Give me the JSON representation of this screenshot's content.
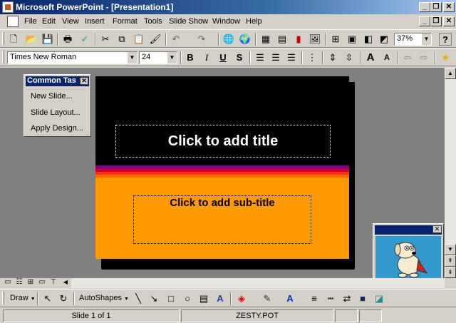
{
  "window": {
    "title": "Microsoft PowerPoint - [Presentation1]",
    "minimize_glyph": "_",
    "maximize_glyph": "❐",
    "close_glyph": "✕"
  },
  "menu": [
    "File",
    "Edit",
    "View",
    "Insert",
    "Format",
    "Tools",
    "Slide Show",
    "Window",
    "Help"
  ],
  "standard_toolbar": {
    "zoom": "37%",
    "help_glyph": "?"
  },
  "formatting_toolbar": {
    "font": "Times New Roman",
    "size": "24",
    "bold": "B",
    "italic": "I",
    "underline": "U",
    "shadow": "S"
  },
  "task_pane": {
    "title": "Common Tas",
    "items": [
      "New Slide...",
      "Slide Layout...",
      "Apply Design..."
    ]
  },
  "slide": {
    "title_placeholder": "Click to add title",
    "subtitle_placeholder": "Click to add sub-title",
    "colors": {
      "background": "#000000",
      "body": "#ff9900",
      "stripes": [
        "#800080",
        "#cc0033",
        "#ff3300",
        "#ff6600"
      ]
    }
  },
  "drawing_toolbar": {
    "draw": "Draw",
    "autoshapes": "AutoShapes"
  },
  "status_bar": {
    "slide": "Slide 1 of 1",
    "design": "ZESTY.POT"
  },
  "colors": {
    "title_bar": "#0a246a",
    "workspace": "#808080",
    "chrome": "#d4d0c8"
  }
}
